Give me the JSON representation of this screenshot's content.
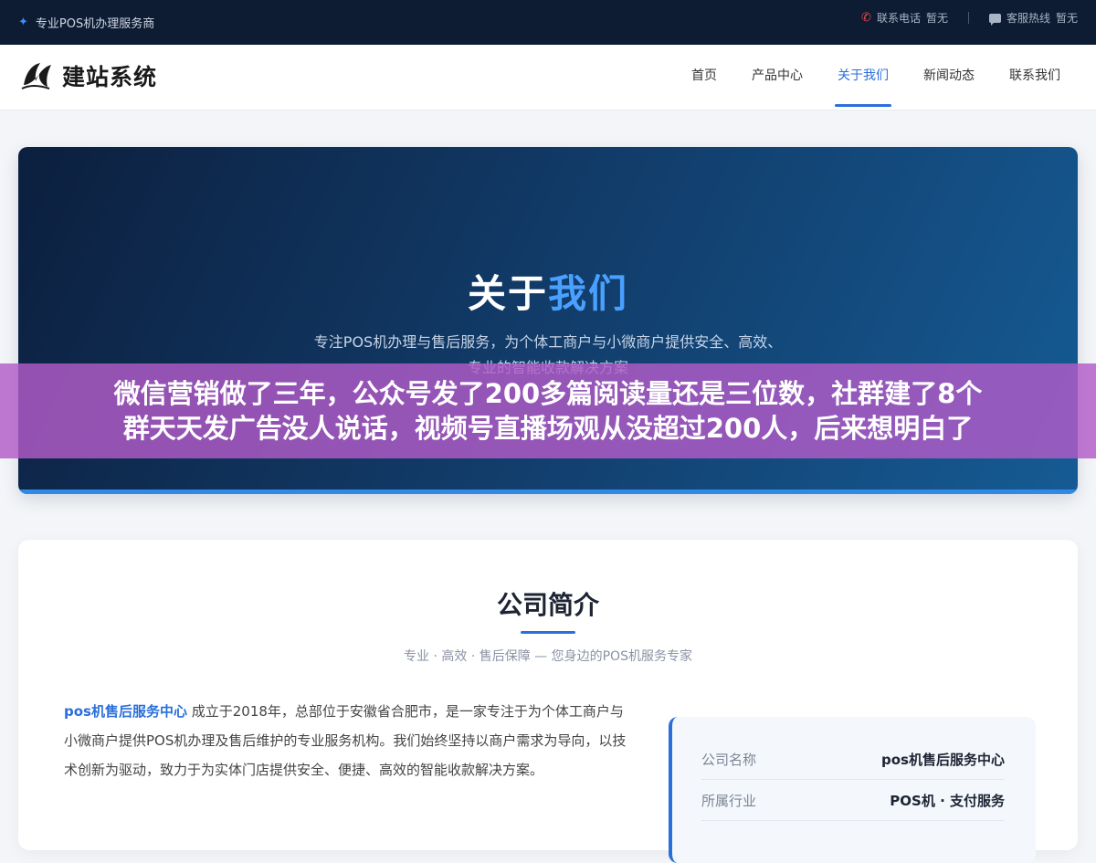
{
  "topbar": {
    "left_text": "专业POS机办理服务商",
    "phone_label": "联系电话",
    "phone_value": "暂无",
    "hotline_label": "客服热线",
    "hotline_value": "暂无"
  },
  "header": {
    "logo_text": "建站系统",
    "nav": [
      {
        "label": "首页"
      },
      {
        "label": "产品中心"
      },
      {
        "label": "关于我们"
      },
      {
        "label": "新闻动态"
      },
      {
        "label": "联系我们"
      }
    ],
    "active_nav": "关于我们"
  },
  "hero": {
    "title_part1": "关于",
    "title_part2": "我们",
    "subtitle_line1": "专注POS机办理与售后服务，为个体工商户与小微商户提供安全、高效、",
    "subtitle_line2": "专业的智能收款解决方案"
  },
  "overlay": {
    "line1": "微信营销做了三年，公众号发了200多篇阅读量还是三位数，社群建了8个",
    "line2": "群天天发广告没人说话，视频号直播场观从没超过200人，后来想明白了"
  },
  "company": {
    "title": "公司简介",
    "subtitle": "专业 · 高效 · 售后保障 — 您身边的POS机服务专家",
    "brand": "pos机售后服务中心",
    "intro": " 成立于2018年，总部位于安徽省合肥市，是一家专注于为个体工商户与小微商户提供POS机办理及售后维护的专业服务机构。我们始终坚持以商户需求为导向，以技术创新为驱动，致力于为实体门店提供安全、便捷、高效的智能收款解决方案。",
    "info": [
      {
        "key": "公司名称",
        "value": "pos机售后服务中心"
      },
      {
        "key": "所属行业",
        "value": "POS机 · 支付服务"
      }
    ]
  },
  "colors": {
    "accent": "#2a6fdb",
    "topbar_bg": "#0d1c33",
    "overlay_bg": "#b25cc8"
  }
}
